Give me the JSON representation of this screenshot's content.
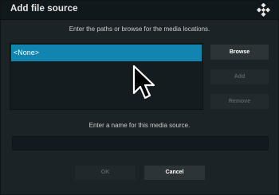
{
  "dialog": {
    "title": "Add file source",
    "instructions": "Enter the paths or browse for the media locations.",
    "sources": [
      {
        "label": "<None>",
        "selected": true
      }
    ],
    "buttons": {
      "browse": "Browse",
      "add": "Add",
      "remove": "Remove"
    },
    "name_label": "Enter a name for this media source.",
    "name_value": "",
    "ok": "OK",
    "cancel": "Cancel"
  },
  "icons": {
    "app_logo": "kodi-logo-icon",
    "pointer": "mouse-pointer-icon"
  },
  "colors": {
    "selection": "#1284b0",
    "dialog_bg": "#1b2327",
    "title_bg": "#10181b"
  }
}
